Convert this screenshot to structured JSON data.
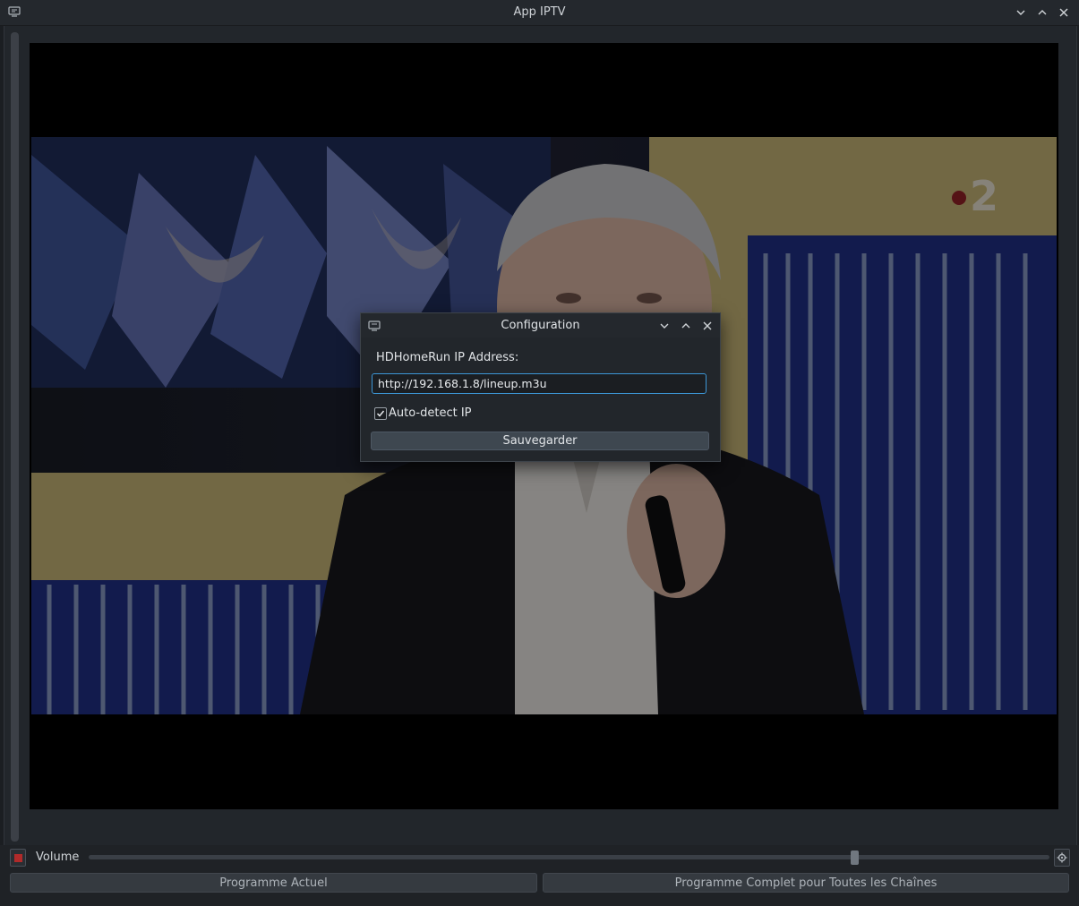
{
  "window": {
    "title": "App IPTV",
    "icon": "screen-icon",
    "buttons": [
      "minimize",
      "maximize",
      "close"
    ]
  },
  "video": {
    "channel_logo": "2"
  },
  "dialog": {
    "title": "Configuration",
    "ip_label": "HDHomeRun IP Address:",
    "ip_value": "http://192.168.1.8/lineup.m3u",
    "autodetect_label": "Auto-detect IP",
    "autodetect_checked": true,
    "save_label": "Sauvegarder"
  },
  "controls": {
    "volume_label": "Volume",
    "volume_level": 0.8,
    "current_program_label": "Programme Actuel",
    "full_program_label": "Programme Complet pour Toutes les Chaînes"
  },
  "colors": {
    "accent": "#3c96d6",
    "stop": "#b02a2a",
    "background": "#22262b"
  }
}
